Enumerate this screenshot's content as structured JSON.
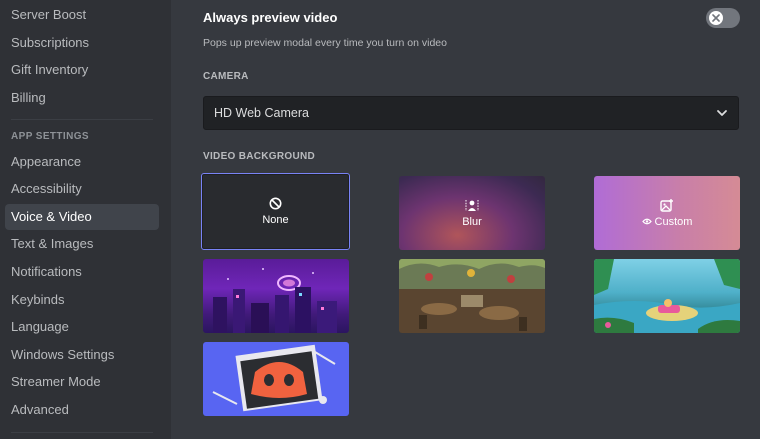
{
  "sidebar": {
    "items_top": [
      {
        "label": "Server Boost"
      },
      {
        "label": "Subscriptions"
      },
      {
        "label": "Gift Inventory"
      },
      {
        "label": "Billing"
      }
    ],
    "section_header": "APP SETTINGS",
    "items_app": [
      {
        "label": "Appearance"
      },
      {
        "label": "Accessibility"
      },
      {
        "label": "Voice & Video",
        "active": true
      },
      {
        "label": "Text & Images"
      },
      {
        "label": "Notifications"
      },
      {
        "label": "Keybinds"
      },
      {
        "label": "Language"
      },
      {
        "label": "Windows Settings"
      },
      {
        "label": "Streamer Mode"
      },
      {
        "label": "Advanced"
      }
    ]
  },
  "preview": {
    "title": "Always preview video",
    "description": "Pops up preview modal every time you turn on video",
    "enabled": false
  },
  "camera": {
    "section_title": "CAMERA",
    "selected": "HD Web Camera"
  },
  "video_background": {
    "section_title": "VIDEO BACKGROUND",
    "none_label": "None",
    "blur_label": "Blur",
    "custom_label": "Custom",
    "selected": "None"
  },
  "colors": {
    "accent": "#5865f2",
    "sidebar_bg": "#2f3136",
    "main_bg": "#36393f",
    "select_bg": "#202225"
  }
}
